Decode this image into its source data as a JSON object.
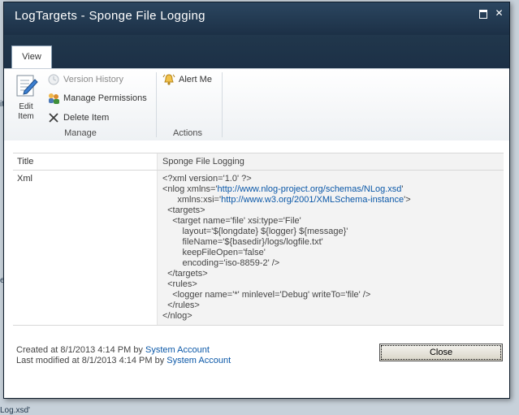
{
  "window": {
    "title": "LogTargets - Sponge File Logging"
  },
  "background_fragments": [
    "it",
    "e",
    "Log.xsd'"
  ],
  "ribbon": {
    "tab_label": "View",
    "manage_group": {
      "label": "Manage",
      "edit_item": [
        "Edit",
        "Item"
      ],
      "version_history": "Version History",
      "manage_permissions": "Manage Permissions",
      "delete_item": "Delete Item"
    },
    "actions_group": {
      "label": "Actions",
      "alert_me": "Alert Me"
    }
  },
  "fields": {
    "title_label": "Title",
    "title_value": "Sponge File Logging",
    "xml_label": "Xml",
    "xml": {
      "line1": "<?xml version='1.0' ?>",
      "line2_pre": "<nlog xmlns='",
      "line2_link": "http://www.nlog-project.org/schemas/NLog.xsd",
      "line2_post": "'",
      "line3_pre": "      xmlns:xsi='",
      "line3_link": "http://www.w3.org/2001/XMLSchema-instance",
      "line3_post": "'>",
      "rest": "  <targets>\n    <target name='file' xsi:type='File'\n        layout='${longdate} ${logger} ${message}'\n        fileName='${basedir}/logs/logfile.txt'\n        keepFileOpen='false'\n        encoding='iso-8859-2' />\n  </targets>\n  <rules>\n    <logger name='*' minlevel='Debug' writeTo='file' />\n  </rules>\n</nlog>"
    }
  },
  "footer": {
    "created_prefix": "Created at 8/1/2013 4:14 PM by",
    "created_by": "System Account",
    "modified_prefix": "Last modified at 8/1/2013 4:14 PM by",
    "modified_by": "System Account"
  },
  "close_button": "Close"
}
